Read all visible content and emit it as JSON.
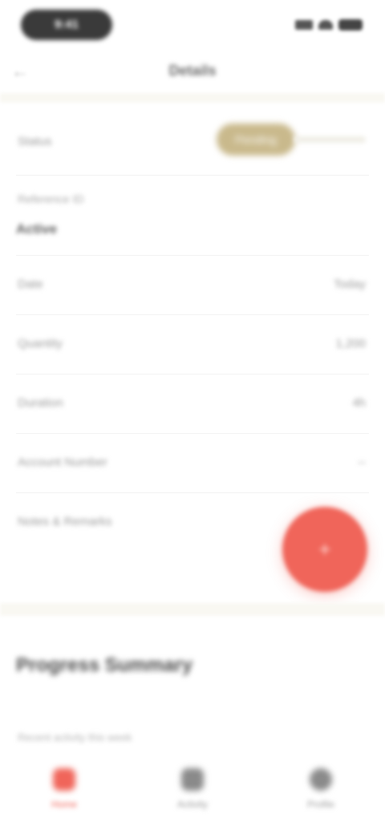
{
  "status_bar": {
    "time": "9:41"
  },
  "nav": {
    "back_glyph": "←",
    "title": "Details"
  },
  "status_row": {
    "label": "Status",
    "chip": "Pending"
  },
  "info_block": {
    "label": "Reference ID",
    "value": "Active"
  },
  "rows": [
    {
      "label": "Date",
      "value": "Today"
    },
    {
      "label": "Quantity",
      "value": "1,200"
    },
    {
      "label": "Duration",
      "value": "4h"
    },
    {
      "label": "Account Number",
      "value": "--"
    },
    {
      "label": "Notes & Remarks",
      "value": ""
    }
  ],
  "fab": {
    "glyph": "+"
  },
  "section": {
    "title": "Progress Summary",
    "subtitle": "Recent activity this week"
  },
  "tabs": [
    {
      "label": "Home",
      "color": "#f0655a"
    },
    {
      "label": "Activity",
      "color": "#9a9a9a"
    },
    {
      "label": "Profile",
      "color": "#9a9a9a"
    }
  ]
}
